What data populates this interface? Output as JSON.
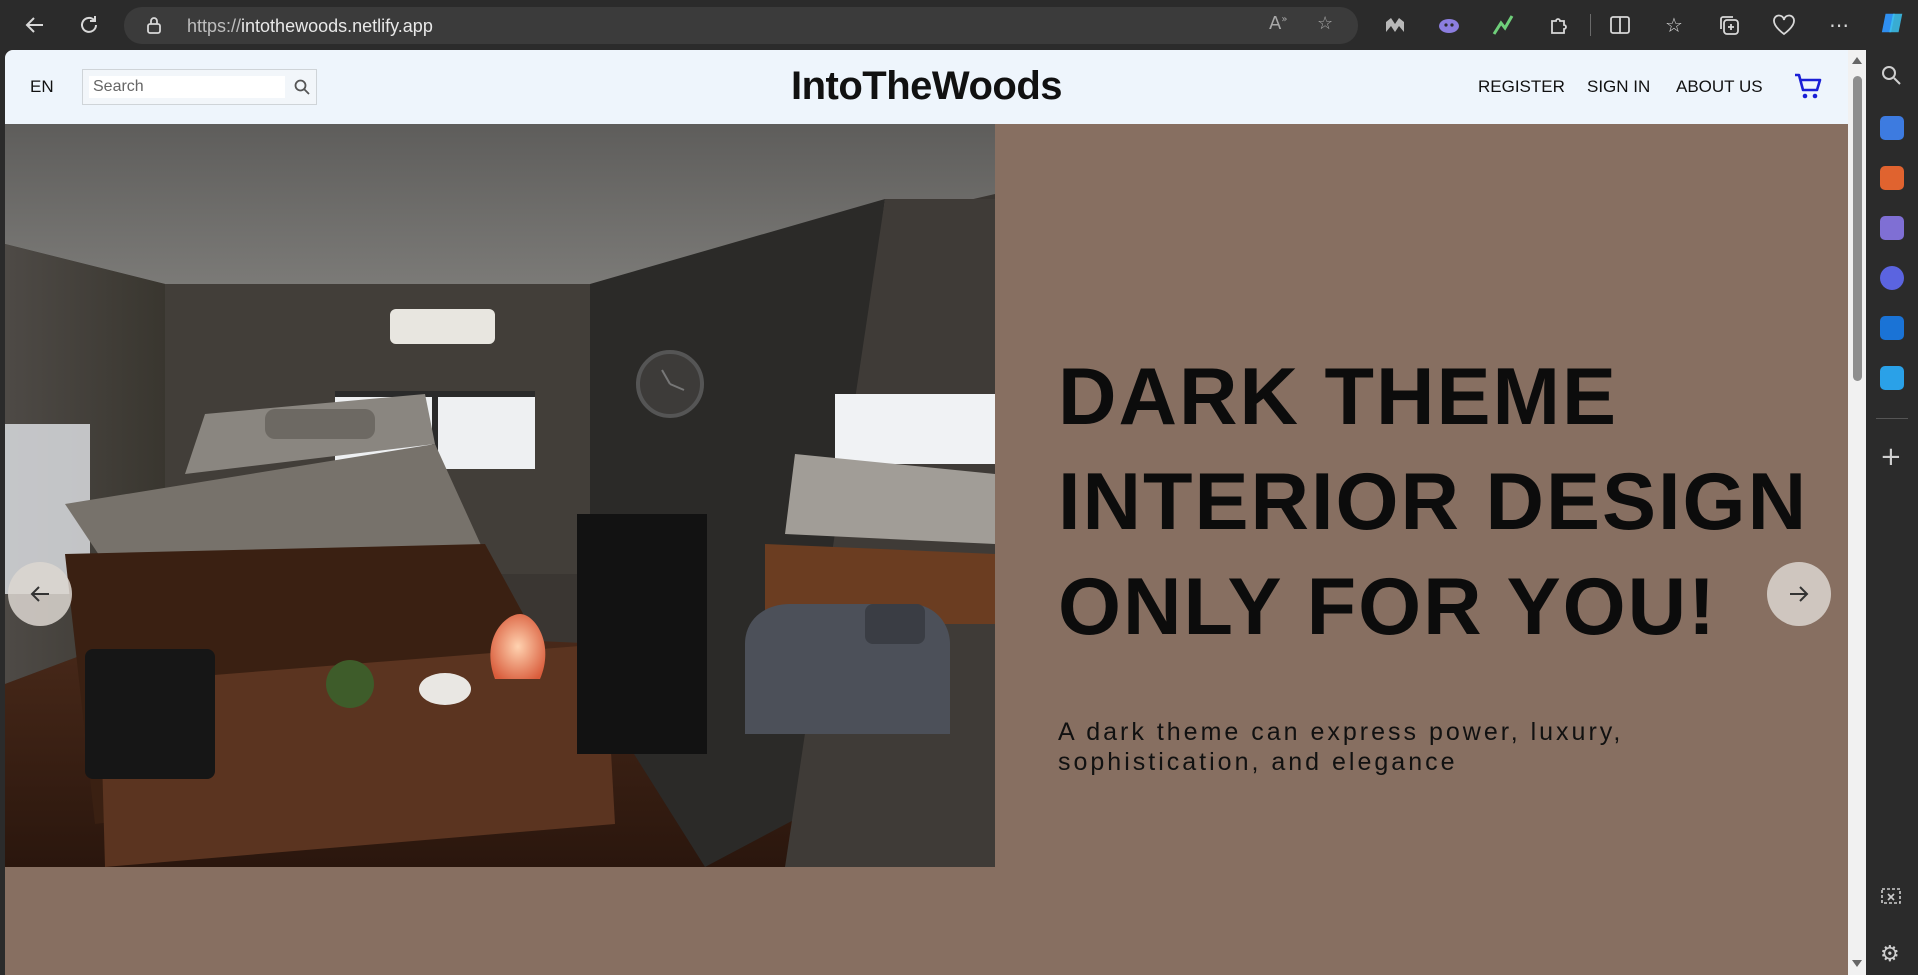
{
  "browser": {
    "url_prefix": "https://",
    "url_host": "intothewoods.netlify.app"
  },
  "header": {
    "language": "EN",
    "search_placeholder": "Search",
    "brand": "IntoTheWoods",
    "nav": [
      "REGISTER",
      "SIGN IN",
      "ABOUT US"
    ]
  },
  "hero": {
    "title_lines": [
      "DARK THEME",
      "INTERIOR DESIGN",
      "ONLY FOR YOU!"
    ],
    "subtitle_line1": "A dark theme can express power, luxury,",
    "subtitle_line2": "sophistication, and elegance"
  },
  "colors": {
    "hero_background": "#876f61",
    "header_background": "#eef5fc",
    "cart_icon": "#1a1fd6"
  }
}
